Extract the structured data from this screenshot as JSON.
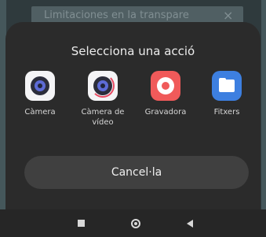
{
  "background": {
    "banner_text": "Limitaciones en la transpare",
    "banner_close": "×"
  },
  "sheet": {
    "title": "Selecciona una acció",
    "actions": [
      {
        "label": "Càmera",
        "icon": "camera-icon"
      },
      {
        "label": "Càmera de\nvídeo",
        "icon": "video-camera-icon"
      },
      {
        "label": "Gravadora",
        "icon": "recorder-icon"
      },
      {
        "label": "Fitxers",
        "icon": "folder-icon"
      }
    ],
    "cancel_label": "Cancel·la"
  },
  "navbar": {
    "buttons": [
      "recent-apps",
      "home",
      "back"
    ]
  },
  "colors": {
    "sheet_bg": "#2b2b2b",
    "button_bg": "#404040",
    "recorder": "#f05a5a",
    "files": "#3d7fe0"
  }
}
